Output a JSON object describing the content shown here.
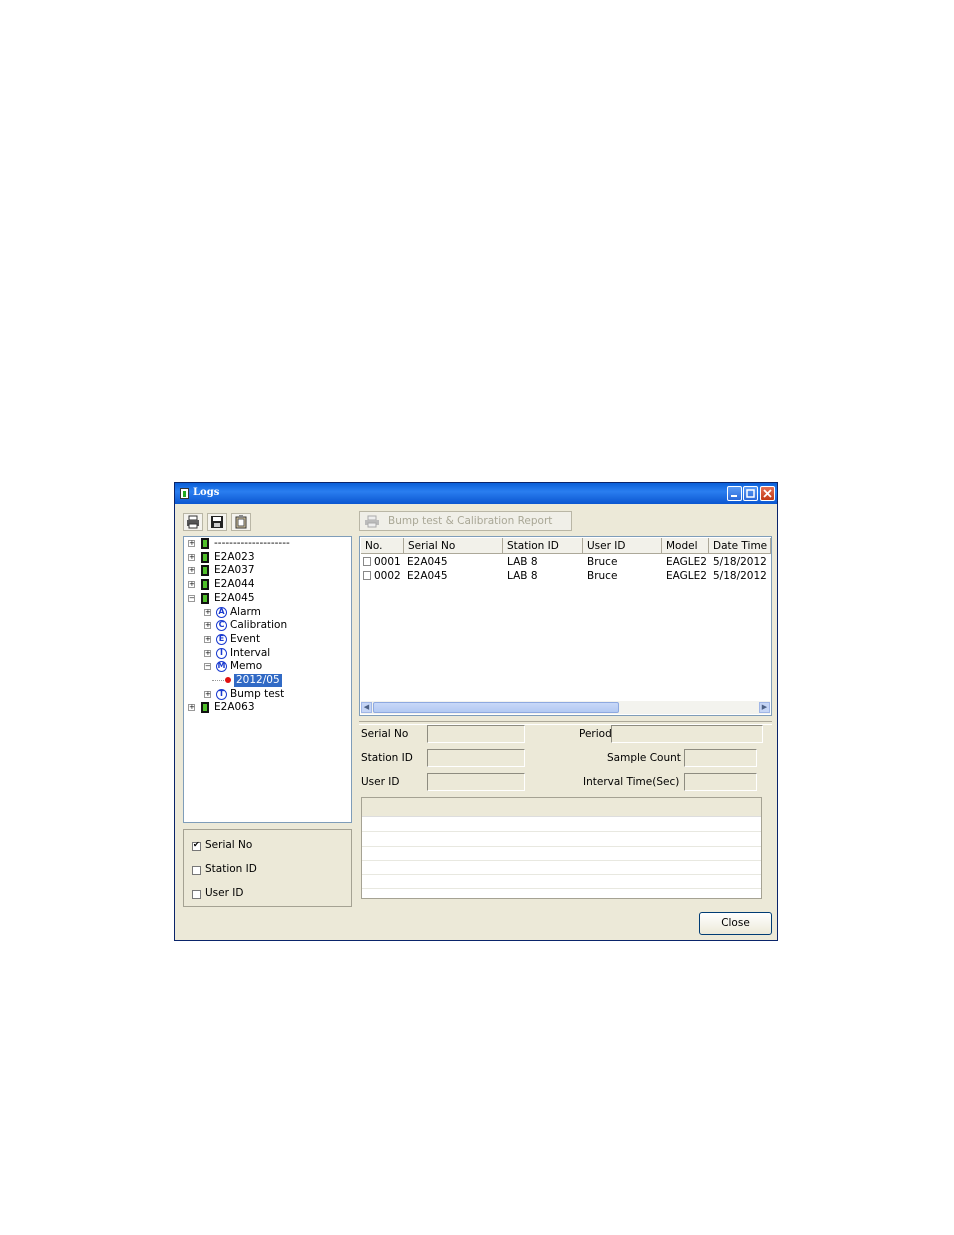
{
  "window": {
    "title": "Logs",
    "report_button": "Bump test & Calibration Report",
    "close_button": "Close"
  },
  "toolbar": {
    "icons": [
      "printer-icon",
      "save-icon",
      "clipboard-icon"
    ]
  },
  "tree": {
    "nodes": [
      {
        "label": "--------------------",
        "level": 0
      },
      {
        "label": "E2A023",
        "level": 0
      },
      {
        "label": "E2A037",
        "level": 0
      },
      {
        "label": "E2A044",
        "level": 0
      },
      {
        "label": "E2A045",
        "level": 0,
        "expanded": true
      },
      {
        "label": "Alarm",
        "level": 1,
        "letter": "A"
      },
      {
        "label": "Calibration",
        "level": 1,
        "letter": "C"
      },
      {
        "label": "Event",
        "level": 1,
        "letter": "E"
      },
      {
        "label": "Interval",
        "level": 1,
        "letter": "I"
      },
      {
        "label": "Memo",
        "level": 1,
        "letter": "M",
        "expanded": true
      },
      {
        "label": "2012/05",
        "level": 2,
        "selected": true
      },
      {
        "label": "Bump test",
        "level": 1,
        "letter": "T"
      },
      {
        "label": "E2A063",
        "level": 0
      }
    ]
  },
  "filters": [
    {
      "label": "Serial No",
      "checked": true
    },
    {
      "label": "Station ID",
      "checked": false
    },
    {
      "label": "User ID",
      "checked": false
    }
  ],
  "list": {
    "columns": [
      "No.",
      "Serial No",
      "Station ID",
      "User ID",
      "Model",
      "Date Time"
    ],
    "rows": [
      [
        "0001",
        "E2A045",
        "LAB 8",
        "Bruce",
        "EAGLE2",
        "5/18/2012"
      ],
      [
        "0002",
        "E2A045",
        "LAB 8",
        "Bruce",
        "EAGLE2",
        "5/18/2012"
      ]
    ]
  },
  "details": {
    "serial_no": "Serial No",
    "station_id": "Station ID",
    "user_id": "User ID",
    "period": "Period",
    "sample_count": "Sample Count",
    "interval_time": "Interval Time(Sec)"
  }
}
